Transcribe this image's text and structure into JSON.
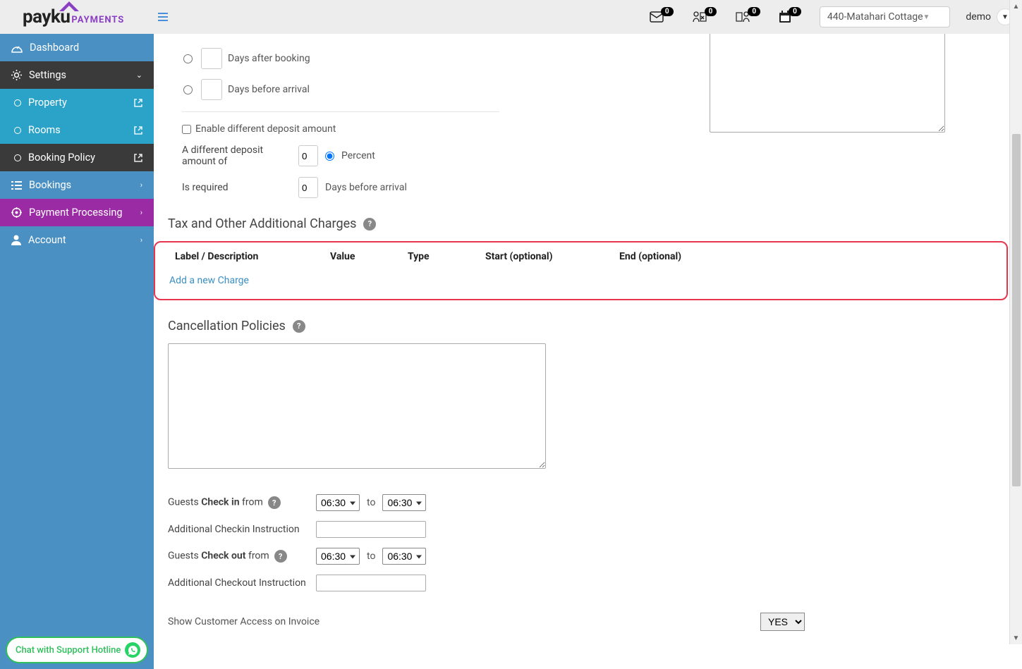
{
  "logo": {
    "main": "payku",
    "sub": "PAYMENTS"
  },
  "top": {
    "badges": {
      "mail": "0",
      "checkin": "0",
      "checkout": "0",
      "calendar": "0"
    },
    "property": "440-Matahari Cottage",
    "user": "demo"
  },
  "sidebar": {
    "dashboard": "Dashboard",
    "settings": "Settings",
    "property": "Property",
    "rooms": "Rooms",
    "booking_policy": "Booking Policy",
    "bookings": "Bookings",
    "payment_processing": "Payment Processing",
    "account": "Account"
  },
  "chat": "Chat with Support Hotline",
  "deposit": {
    "days_after_booking": "Days after booking",
    "days_before_arrival": "Days before arrival",
    "enable_diff": "Enable different deposit amount",
    "diff_label": "A different deposit amount of",
    "diff_value": "0",
    "percent": "Percent",
    "required_label": "Is required",
    "required_value": "0",
    "required_suffix": "Days before arrival"
  },
  "tax_section": {
    "title": "Tax and Other Additional Charges",
    "headers": {
      "label": "Label / Description",
      "value": "Value",
      "type": "Type",
      "start": "Start (optional)",
      "end": "End (optional)"
    },
    "add_link": "Add a new Charge"
  },
  "cancellation": {
    "title": "Cancellation Policies"
  },
  "checkin": {
    "guests": "Guests ",
    "checkin_bold": "Check in",
    "checkout_bold": "Check out",
    "from": " from",
    "to": "to",
    "time1": "06:30",
    "time2": "06:30",
    "addl_checkin": "Additional Checkin Instruction",
    "addl_checkout": "Additional Checkout Instruction"
  },
  "invoice": {
    "label": "Show Customer Access on Invoice",
    "value": "YES"
  }
}
